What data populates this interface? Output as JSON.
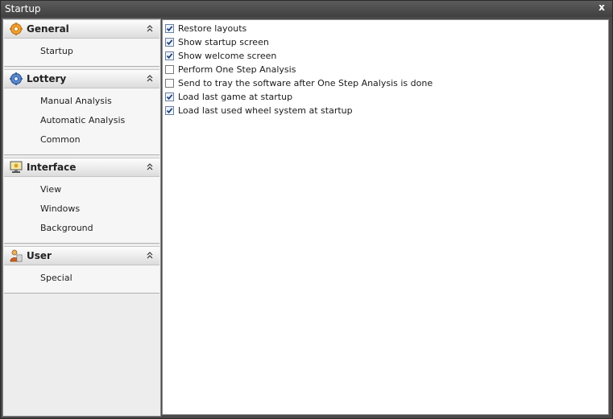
{
  "window": {
    "title": "Startup",
    "close_glyph": "x"
  },
  "sidebar": {
    "groups": [
      {
        "title": "General",
        "icon": "gear-icon",
        "items": [
          "Startup"
        ]
      },
      {
        "title": "Lottery",
        "icon": "settings-globe-icon",
        "items": [
          "Manual Analysis",
          "Automatic Analysis",
          "Common"
        ]
      },
      {
        "title": "Interface",
        "icon": "monitor-icon",
        "items": [
          "View",
          "Windows",
          "Background"
        ]
      },
      {
        "title": "User",
        "icon": "user-icon",
        "items": [
          "Special"
        ]
      }
    ]
  },
  "options": [
    {
      "label": "Restore layouts",
      "checked": true
    },
    {
      "label": "Show startup screen",
      "checked": true
    },
    {
      "label": "Show welcome screen",
      "checked": true
    },
    {
      "label": "Perform One Step Analysis",
      "checked": false
    },
    {
      "label": "Send to tray the software after One Step Analysis is done",
      "checked": false
    },
    {
      "label": "Load last game at startup",
      "checked": true
    },
    {
      "label": "Load last used wheel system at startup",
      "checked": true
    }
  ],
  "colors": {
    "accent": "#2a5a9a",
    "titlebar": "#4a4a4a",
    "check": "#1f3f7a"
  }
}
